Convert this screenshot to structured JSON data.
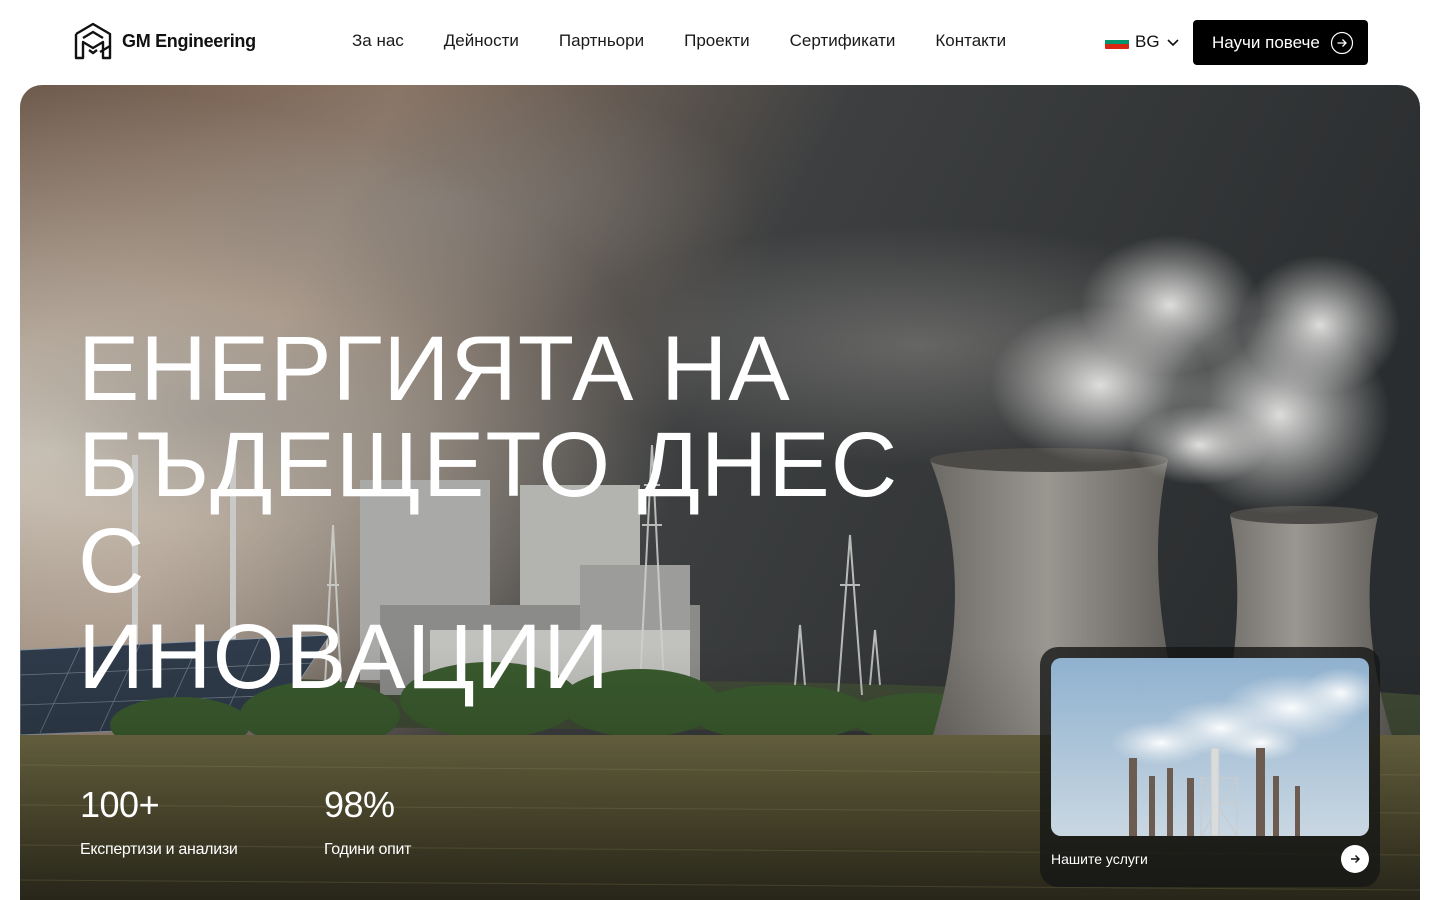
{
  "brand": {
    "name": "GM Engineering",
    "logo_icon": "gm-monogram-icon"
  },
  "nav": {
    "items": [
      {
        "label": "За нас"
      },
      {
        "label": "Дейности"
      },
      {
        "label": "Партньори"
      },
      {
        "label": "Проекти"
      },
      {
        "label": "Сертификати"
      },
      {
        "label": "Контакти"
      }
    ]
  },
  "language": {
    "code": "BG",
    "flag_colors": [
      "#ffffff",
      "#00966e",
      "#d62612"
    ],
    "icon": "chevron-down-icon"
  },
  "cta": {
    "label": "Научи повече",
    "icon": "arrow-right-circle-icon"
  },
  "hero": {
    "title_lines": [
      "ЕНЕРГИЯТА НА",
      "БЪДЕЩЕТО ДНЕС С",
      "ИНОВАЦИИ"
    ],
    "stats": [
      {
        "value": "100+",
        "label": "Експертизи и анализи"
      },
      {
        "value": "98%",
        "label": "Години опит"
      }
    ],
    "services_card": {
      "label": "Нашите услуги",
      "icon": "arrow-right-icon"
    }
  },
  "colors": {
    "accent": "#000000",
    "hero_text": "#ffffff"
  }
}
